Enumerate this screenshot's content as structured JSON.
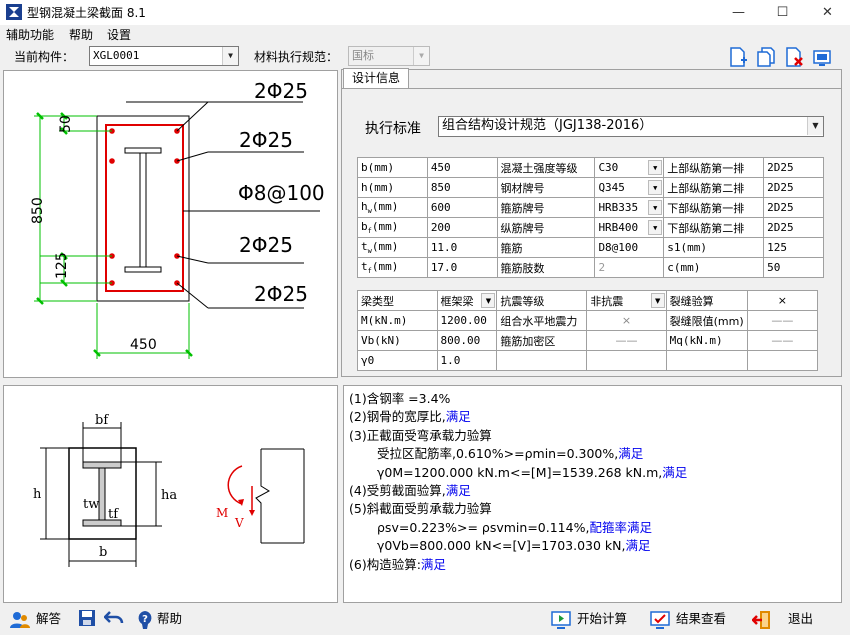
{
  "window": {
    "title": "型钢混凝土梁截面 8.1",
    "min": "—",
    "max": "☐",
    "close": "✕"
  },
  "menu": [
    "辅助功能",
    "帮助",
    "设置"
  ],
  "toolbar": {
    "component_label": "当前构件：",
    "component_value": "XGL0001",
    "code_label": "材料执行规范：",
    "code_value": "国标"
  },
  "section_drawing": {
    "top1": "2Φ25",
    "top2": "2Φ25",
    "stirrup": "Φ8@100",
    "bot2": "2Φ25",
    "bot1": "2Φ25",
    "dim_50": "50",
    "dim_850": "850",
    "dim_125": "125",
    "dim_450": "450"
  },
  "steel_drawing": {
    "bf": "bf",
    "h": "h",
    "ha": "ha",
    "tw": "tw",
    "tf": "tf",
    "b": "b",
    "M": "M",
    "V": "V"
  },
  "tab": {
    "label": "设计信息"
  },
  "standard": {
    "label": "执行标准",
    "value": "组合结构设计规范（JGJ138-2016）"
  },
  "grid1": [
    [
      "b(mm)",
      "450",
      "混凝土强度等级",
      "C30",
      "上部纵筋第一排",
      "2D25"
    ],
    [
      "h(mm)",
      "850",
      "钢材牌号",
      "Q345",
      "上部纵筋第二排",
      "2D25"
    ],
    [
      "hw(mm)",
      "600",
      "箍筋牌号",
      "HRB335",
      "下部纵筋第一排",
      "2D25"
    ],
    [
      "bf(mm)",
      "200",
      "纵筋牌号",
      "HRB400",
      "下部纵筋第二排",
      "2D25"
    ],
    [
      "tw(mm)",
      "11.0",
      "箍筋",
      "D8@100",
      "s1(mm)",
      "125"
    ],
    [
      "tf(mm)",
      "17.0",
      "箍筋肢数",
      "2",
      "c(mm)",
      "50"
    ]
  ],
  "grid2": [
    [
      "梁类型",
      "框架梁",
      "抗震等级",
      "非抗震",
      "裂缝验算",
      "×"
    ],
    [
      "M(kN.m)",
      "1200.00",
      "组合水平地震力",
      "×",
      "裂缝限值(mm)",
      "——"
    ],
    [
      "Vb(kN)",
      "800.00",
      "箍筋加密区",
      "——",
      "Mq(kN.m)",
      "——"
    ],
    [
      "γ0",
      "1.0",
      "",
      "",
      "",
      ""
    ]
  ],
  "result": {
    "l1": "(1)含钢率 =3.4%",
    "l2a": "(2)钢骨的宽厚比,",
    "l2b": "满足",
    "l3": "(3)正截面受弯承载力验算",
    "l4a": "受拉区配筋率,0.610%>=ρmin=0.300%,",
    "l4b": "满足",
    "l5a": "γ0M=1200.000 kN.m<=[M]=1539.268 kN.m,",
    "l5b": "满足",
    "l6a": "(4)受剪截面验算,",
    "l6b": "满足",
    "l7": "(5)斜截面受剪承载力验算",
    "l8a": "ρsv=0.223%>= ρsvmin=0.114%,",
    "l8b": "配箍率满足",
    "l9a": "γ0Vb=800.000 kN<=[V]=1703.030 kN,",
    "l9b": "满足",
    "l10a": "(6)构造验算:",
    "l10b": "满足"
  },
  "status": {
    "answer": "解答",
    "help": "帮助",
    "start": "开始计算",
    "view": "结果查看",
    "exit": "退出"
  },
  "colors": {
    "rebar": "#e00000",
    "dim": "#00c000",
    "ok": "#0000ee"
  }
}
